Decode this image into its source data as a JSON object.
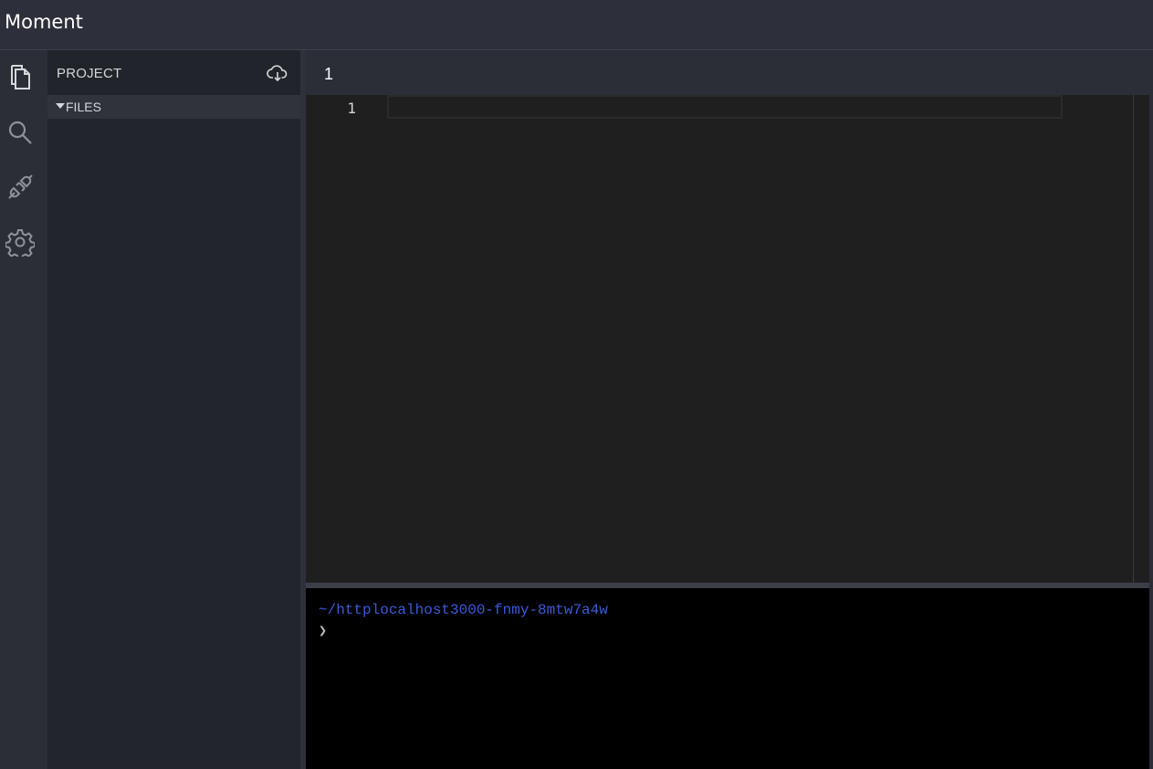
{
  "app": {
    "title": "Moment"
  },
  "activity_bar": {
    "items": [
      {
        "icon": "files-icon"
      },
      {
        "icon": "search-icon"
      },
      {
        "icon": "plug-icon"
      },
      {
        "icon": "gear-icon"
      }
    ]
  },
  "sidebar": {
    "title": "PROJECT",
    "action_icon": "cloud-download-icon",
    "section_label": "FILES"
  },
  "editor": {
    "tab_label": "1",
    "line_numbers": [
      "1"
    ]
  },
  "terminal": {
    "path": "~/httplocalhost3000-fnmy-8mtw7a4w",
    "prompt": "❯"
  },
  "colors": {
    "titlebar": "#2d303a",
    "sidebar": "#22252c",
    "editor_bg": "#1f1f1f",
    "terminal_bg": "#000000",
    "terminal_path": "#3b5bdb"
  }
}
